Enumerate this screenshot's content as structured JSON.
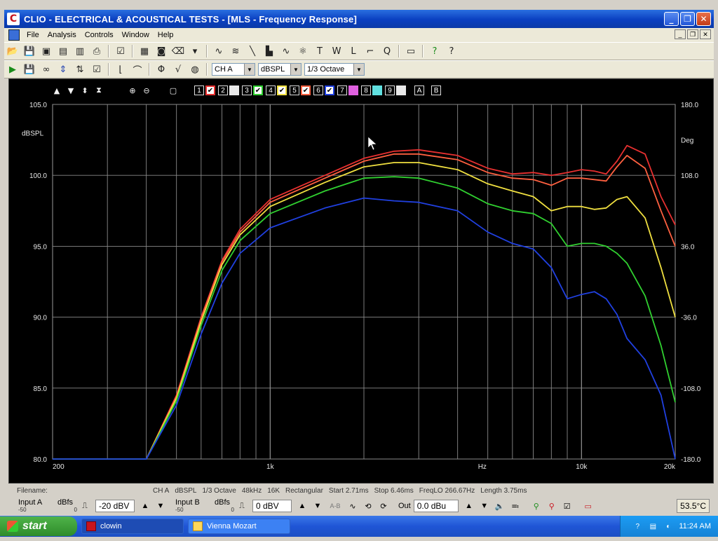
{
  "window": {
    "title": "CLIO - ELECTRICAL & ACOUSTICAL TESTS - [MLS - Frequency Response]",
    "logo_glyph": "C"
  },
  "menu": [
    "File",
    "Analysis",
    "Controls",
    "Window",
    "Help"
  ],
  "toolbar2": {
    "channel": "CH A",
    "unit": "dBSPL",
    "smoothing": "1/3 Octave"
  },
  "graph_toolbar": {
    "slots": [
      {
        "num": "1",
        "checked": true,
        "color": "#e83030"
      },
      {
        "num": "2",
        "checked": false,
        "color": "#e8e8e8"
      },
      {
        "num": "3",
        "checked": true,
        "color": "#30d030"
      },
      {
        "num": "4",
        "checked": true,
        "color": "#f0e040"
      },
      {
        "num": "5",
        "checked": true,
        "color": "#ff6040"
      },
      {
        "num": "6",
        "checked": true,
        "color": "#2040e0"
      },
      {
        "num": "7",
        "checked": false,
        "color": "#e060e0"
      },
      {
        "num": "8",
        "checked": false,
        "color": "#60e0e0"
      },
      {
        "num": "9",
        "checked": false,
        "color": "#e8e8e8"
      }
    ],
    "a_label": "A",
    "b_label": "B"
  },
  "chart_data": {
    "type": "line",
    "xlabel": "Hz",
    "ylabel": "dBSPL",
    "y2label": "Deg",
    "xscale": "log",
    "xlim": [
      200,
      20000
    ],
    "ylim": [
      80,
      105
    ],
    "y2lim": [
      -180,
      180
    ],
    "grid": true,
    "xticks": [
      {
        "v": 200,
        "label": "200"
      },
      {
        "v": 1000,
        "label": "1k"
      },
      {
        "v": 10000,
        "label": "10k"
      },
      {
        "v": 20000,
        "label": "20k"
      }
    ],
    "yticks": [
      {
        "v": 80,
        "label": "80.0"
      },
      {
        "v": 85,
        "label": "85.0"
      },
      {
        "v": 90,
        "label": "90.0"
      },
      {
        "v": 95,
        "label": "95.0"
      },
      {
        "v": 100,
        "label": "100.0"
      },
      {
        "v": 105,
        "label": "105.0"
      }
    ],
    "y2ticks": [
      {
        "v": -180,
        "label": "-180.0"
      },
      {
        "v": -108,
        "label": "-108.0"
      },
      {
        "v": -36,
        "label": "-36.0"
      },
      {
        "v": 36,
        "label": "36.0"
      },
      {
        "v": 108,
        "label": "108.0"
      },
      {
        "v": 180,
        "label": "180.0"
      }
    ],
    "series": [
      {
        "color": "#e83030",
        "x": [
          200,
          400,
          500,
          600,
          700,
          800,
          1000,
          1500,
          2000,
          2500,
          3000,
          4000,
          5000,
          6000,
          7000,
          8000,
          9000,
          10000,
          11000,
          12000,
          13000,
          14000,
          16000,
          18000,
          20000
        ],
        "y": [
          80,
          80,
          84.5,
          90,
          94,
          96.2,
          98.3,
          100,
          101.2,
          101.7,
          101.8,
          101.4,
          100.5,
          100.1,
          100.2,
          100.0,
          100.2,
          100.4,
          100.3,
          100.1,
          101,
          102.1,
          101.5,
          98.5,
          96.5
        ]
      },
      {
        "color": "#ff6040",
        "x": [
          200,
          400,
          500,
          600,
          700,
          800,
          1000,
          1500,
          2000,
          2500,
          3000,
          4000,
          5000,
          6000,
          7000,
          8000,
          9000,
          10000,
          11000,
          12000,
          13000,
          14000,
          16000,
          18000,
          20000
        ],
        "y": [
          80,
          80,
          84.4,
          89.9,
          93.9,
          96.0,
          98.1,
          99.8,
          101.0,
          101.5,
          101.5,
          101.1,
          100.2,
          99.8,
          99.7,
          99.3,
          99.8,
          99.8,
          99.7,
          99.6,
          100.6,
          101.4,
          100.5,
          97.5,
          95.0
        ]
      },
      {
        "color": "#f0e040",
        "x": [
          200,
          400,
          500,
          600,
          700,
          800,
          1000,
          1500,
          2000,
          2500,
          3000,
          4000,
          5000,
          6000,
          7000,
          8000,
          9000,
          10000,
          11000,
          12000,
          13000,
          14000,
          16000,
          18000,
          20000
        ],
        "y": [
          80,
          80,
          84.3,
          89.7,
          93.7,
          95.8,
          97.8,
          99.5,
          100.6,
          100.9,
          100.9,
          100.4,
          99.4,
          98.9,
          98.5,
          97.5,
          97.8,
          97.8,
          97.6,
          97.7,
          98.3,
          98.5,
          97.0,
          93.5,
          90.0
        ]
      },
      {
        "color": "#30d030",
        "x": [
          200,
          400,
          500,
          600,
          700,
          800,
          1000,
          1500,
          2000,
          2500,
          3000,
          4000,
          5000,
          6000,
          7000,
          8000,
          9000,
          10000,
          11000,
          12000,
          13000,
          14000,
          16000,
          18000,
          20000
        ],
        "y": [
          80,
          80,
          84.1,
          89.4,
          93.3,
          95.4,
          97.3,
          98.9,
          99.8,
          99.9,
          99.8,
          99.1,
          98.0,
          97.5,
          97.3,
          96.6,
          95.0,
          95.2,
          95.2,
          95.0,
          94.5,
          93.8,
          91.5,
          88.0,
          84.0
        ]
      },
      {
        "color": "#2040e0",
        "x": [
          200,
          400,
          500,
          600,
          700,
          800,
          1000,
          1500,
          2000,
          2500,
          3000,
          4000,
          5000,
          6000,
          7000,
          8000,
          9000,
          10000,
          11000,
          12000,
          13000,
          14000,
          16000,
          18000,
          20000
        ],
        "y": [
          80,
          80,
          83.8,
          88.8,
          92.4,
          94.5,
          96.3,
          97.7,
          98.4,
          98.2,
          98.1,
          97.5,
          96.0,
          95.2,
          94.8,
          93.5,
          91.3,
          91.6,
          91.8,
          91.3,
          90.2,
          88.5,
          87.0,
          84.5,
          80.0
        ]
      }
    ]
  },
  "infobar": {
    "filename_label": "Filename:",
    "items": [
      "CH A",
      "dBSPL",
      "1/3 Octave",
      "48kHz",
      "16K",
      "Rectangular",
      "Start 2.71ms",
      "Stop 6.46ms",
      "FreqLO 266.67Hz",
      "Length 3.75ms"
    ]
  },
  "controlbar": {
    "input_a_label": "Input A",
    "input_a_scale": "-50",
    "input_a_zero": "0",
    "dbfs_label": "dBfs",
    "input_a_value": "-20 dBV",
    "input_b_label": "Input B",
    "input_b_scale": "-50",
    "input_b_zero": "0",
    "input_b_value": "0 dBV",
    "ab_label": "A-B",
    "out_label": "Out",
    "out_value": "0.0 dBu",
    "temperature": "53.5°C"
  },
  "taskbar": {
    "start_label": "start",
    "tasks": [
      {
        "label": "clowin",
        "active": true
      },
      {
        "label": "Vienna Mozart",
        "active": false
      }
    ],
    "clock": "11:24 AM"
  }
}
